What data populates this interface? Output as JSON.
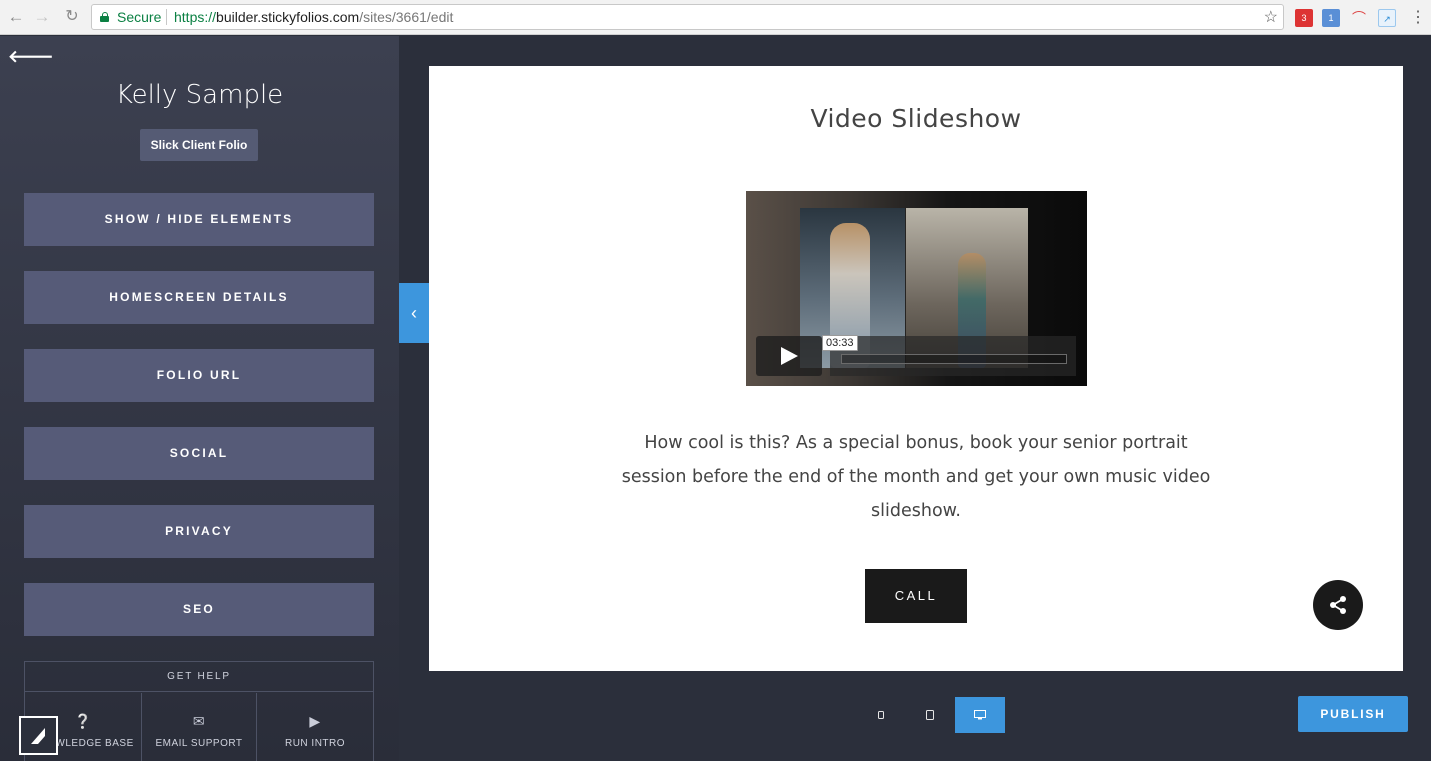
{
  "browser": {
    "secure_label": "Secure",
    "url_scheme": "https://",
    "url_host": "builder.stickyfolios.com",
    "url_path": "/sites/3661/edit",
    "ext_badge_1": "3",
    "ext_badge_2": "1"
  },
  "sidebar": {
    "site_title": "Kelly Sample",
    "folio_badge": "Slick Client Folio",
    "menu": [
      {
        "label": "SHOW / HIDE ELEMENTS"
      },
      {
        "label": "HOMESCREEN DETAILS"
      },
      {
        "label": "FOLIO URL"
      },
      {
        "label": "SOCIAL"
      },
      {
        "label": "PRIVACY"
      },
      {
        "label": "SEO"
      }
    ],
    "help": {
      "title": "GET HELP",
      "items": [
        {
          "label": "KNOWLEDGE BASE",
          "icon": "question-circle-icon"
        },
        {
          "label": "EMAIL SUPPORT",
          "icon": "envelope-icon"
        },
        {
          "label": "RUN INTRO",
          "icon": "play-icon"
        }
      ]
    }
  },
  "preview": {
    "title": "Video Slideshow",
    "video": {
      "time_tooltip": "03:33"
    },
    "body": "How cool is this? As a special bonus, book your senior portrait session before the end of the month and get your own music video slideshow.",
    "call_label": "CALL"
  },
  "bottom_bar": {
    "publish_label": "PUBLISH",
    "active_device": "desktop"
  },
  "colors": {
    "accent": "#3d96dd",
    "sidebar_button": "#565b78",
    "secure_green": "#0b8043"
  }
}
